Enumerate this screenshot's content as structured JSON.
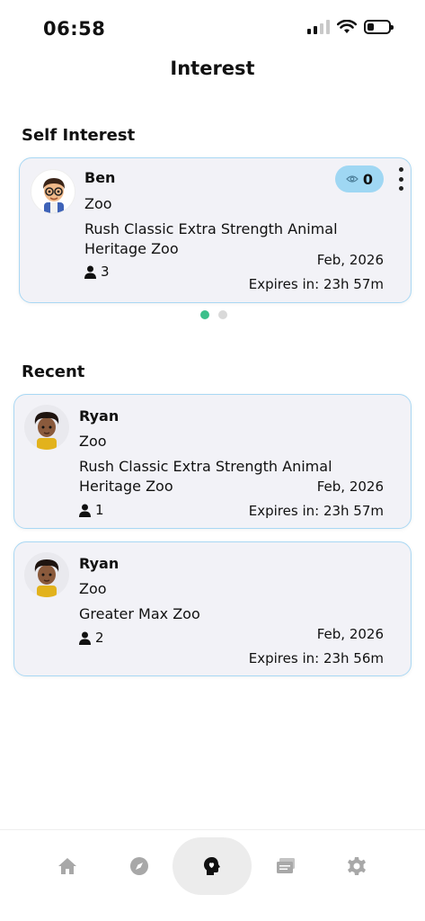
{
  "status_bar": {
    "time": "06:58"
  },
  "header": {
    "title": "Interest"
  },
  "self_interest": {
    "heading": "Self Interest",
    "card": {
      "name": "Ben",
      "category": "Zoo",
      "description": "Rush Classic Extra Strength Animal Heritage Zoo",
      "count": "3",
      "date": "Feb, 2026",
      "expires": "Expires in: 23h 57m",
      "views": "0"
    },
    "pager_active": 0,
    "pager_total": 2
  },
  "recent": {
    "heading": "Recent",
    "items": [
      {
        "name": "Ryan",
        "category": "Zoo",
        "description": "Rush Classic Extra Strength Animal Heritage Zoo",
        "count": "1",
        "date": "Feb, 2026",
        "expires": "Expires in: 23h 57m"
      },
      {
        "name": "Ryan",
        "category": "Zoo",
        "description": "Greater Max Zoo",
        "count": "2",
        "date": "Feb, 2026",
        "expires": "Expires in: 23h 56m"
      }
    ]
  },
  "tabbar": {
    "tabs": [
      {
        "icon": "home-icon",
        "active": false
      },
      {
        "icon": "compass-icon",
        "active": false
      },
      {
        "icon": "head-heart-icon",
        "active": true
      },
      {
        "icon": "tickets-icon",
        "active": false
      },
      {
        "icon": "gear-icon",
        "active": false
      }
    ]
  },
  "colors": {
    "card_bg": "#f2f2f7",
    "card_border": "#a9d8f4",
    "badge": "#9fd7f3",
    "pager_active": "#3cc08b",
    "tab_icon": "#a8a8a8"
  }
}
